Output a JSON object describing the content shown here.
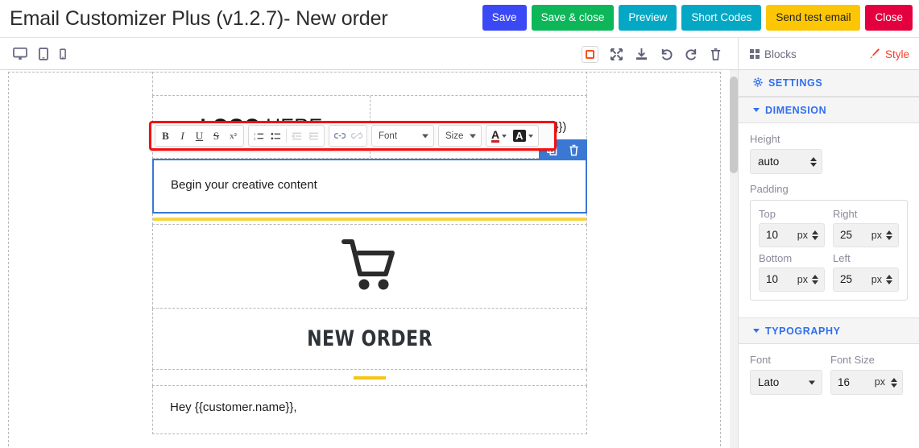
{
  "header": {
    "title": "Email Customizer Plus (v1.2.7)- New order",
    "buttons": [
      {
        "label": "Save",
        "name": "save-button",
        "color": "#3b48f5"
      },
      {
        "label": "Save & close",
        "name": "save-and-close-button",
        "color": "#0eb65a"
      },
      {
        "label": "Preview",
        "name": "preview-button",
        "color": "#04a8c4"
      },
      {
        "label": "Short Codes",
        "name": "short-codes-button",
        "color": "#04a8c4"
      },
      {
        "label": "Send test email",
        "name": "send-test-email-button",
        "color": "#fdc605"
      },
      {
        "label": "Close",
        "name": "close-button",
        "color": "#e4003f"
      }
    ]
  },
  "toolbar": {
    "devices": [
      {
        "icon": "desktop-icon",
        "label": "Desktop"
      },
      {
        "icon": "tablet-icon",
        "label": "Tablet"
      },
      {
        "icon": "mobile-icon",
        "label": "Mobile"
      }
    ],
    "edit_icons": [
      {
        "icon": "border-toggle-icon",
        "label": "Toggle borders",
        "active": true
      },
      {
        "icon": "fullscreen-icon",
        "label": "Fullscreen"
      },
      {
        "icon": "download-icon",
        "label": "Download"
      },
      {
        "icon": "undo-icon",
        "label": "Undo"
      },
      {
        "icon": "redo-icon",
        "label": "Redo"
      },
      {
        "icon": "trash-icon",
        "label": "Delete"
      }
    ],
    "tabs": {
      "blocks_label": "Blocks",
      "style_label": "Style",
      "style_color": "#f4402e"
    }
  },
  "panel": {
    "settings_label": "SETTINGS",
    "dimension": {
      "title": "DIMENSION",
      "height_label": "Height",
      "height_value": "auto",
      "padding_label": "Padding",
      "padding": [
        {
          "label": "Top",
          "value": "10",
          "unit": "px"
        },
        {
          "label": "Right",
          "value": "25",
          "unit": "px"
        },
        {
          "label": "Bottom",
          "value": "10",
          "unit": "px"
        },
        {
          "label": "Left",
          "value": "25",
          "unit": "px"
        }
      ]
    },
    "typography": {
      "title": "TYPOGRAPHY",
      "font_label": "Font",
      "font_value": "Lato",
      "font_size_label": "Font Size",
      "font_size_value": "16",
      "font_size_unit": "px"
    }
  },
  "rte": {
    "bold": "B",
    "italic": "I",
    "underline": "U",
    "strike": "S",
    "superscript": "x²",
    "font_placeholder": "Font",
    "size_placeholder": "Size",
    "text_color_glyph": "A",
    "bg_color_glyph": "A"
  },
  "email": {
    "logo_bold": "LOGO",
    "logo_rest": " HERE",
    "order_line": "Order #{{order.id}} ({{created_at}})",
    "content_text": "Begin your creative content",
    "cart_icon": "shopping-cart-icon",
    "heading": "NEW ORDER",
    "greeting": "Hey {{customer.name}},",
    "accent_yellow": "#f5c518",
    "selection_blue": "#3a78d4"
  }
}
